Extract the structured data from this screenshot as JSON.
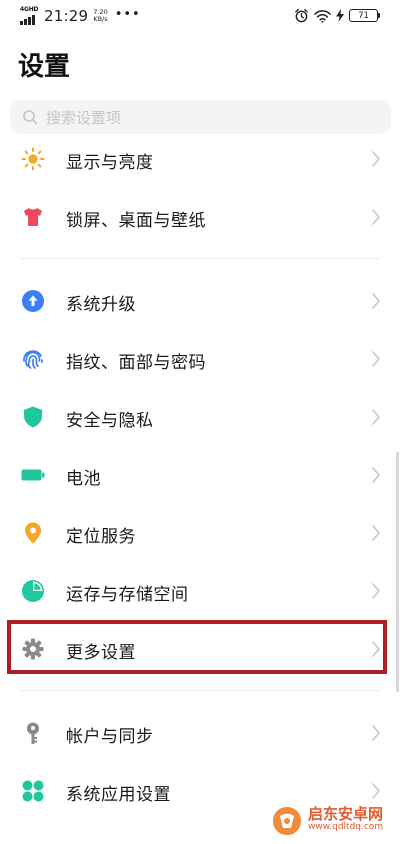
{
  "status_bar": {
    "network": "4GHD",
    "time": "21:29",
    "speed_value": "7.20",
    "speed_unit": "KB/s",
    "more_dots": "•••",
    "battery": "71"
  },
  "page": {
    "title": "设置"
  },
  "search": {
    "placeholder": "搜索设置项"
  },
  "items": [
    {
      "label": "显示与亮度",
      "icon": "sun-icon",
      "color": "#f5a623"
    },
    {
      "label": "锁屏、桌面与壁纸",
      "icon": "tshirt-icon",
      "color": "#f0475e"
    },
    {
      "label": "系统升级",
      "icon": "upgrade-arrow-icon",
      "color": "#3b7ff5"
    },
    {
      "label": "指纹、面部与密码",
      "icon": "fingerprint-icon",
      "color": "#3b7ff5"
    },
    {
      "label": "安全与隐私",
      "icon": "shield-icon",
      "color": "#1fc79a"
    },
    {
      "label": "电池",
      "icon": "battery-icon",
      "color": "#1fc79a"
    },
    {
      "label": "定位服务",
      "icon": "location-pin-icon",
      "color": "#f5a623"
    },
    {
      "label": "运存与存储空间",
      "icon": "pie-chart-icon",
      "color": "#1fc79a"
    },
    {
      "label": "更多设置",
      "icon": "gear-icon",
      "color": "#8a8a8a"
    },
    {
      "label": "帐户与同步",
      "icon": "key-icon",
      "color": "#8a8a8a"
    },
    {
      "label": "系统应用设置",
      "icon": "app-grid-icon",
      "color": "#1fc79a"
    }
  ],
  "watermark": {
    "name": "启东安卓网",
    "url": "www.qdltdq.com"
  }
}
